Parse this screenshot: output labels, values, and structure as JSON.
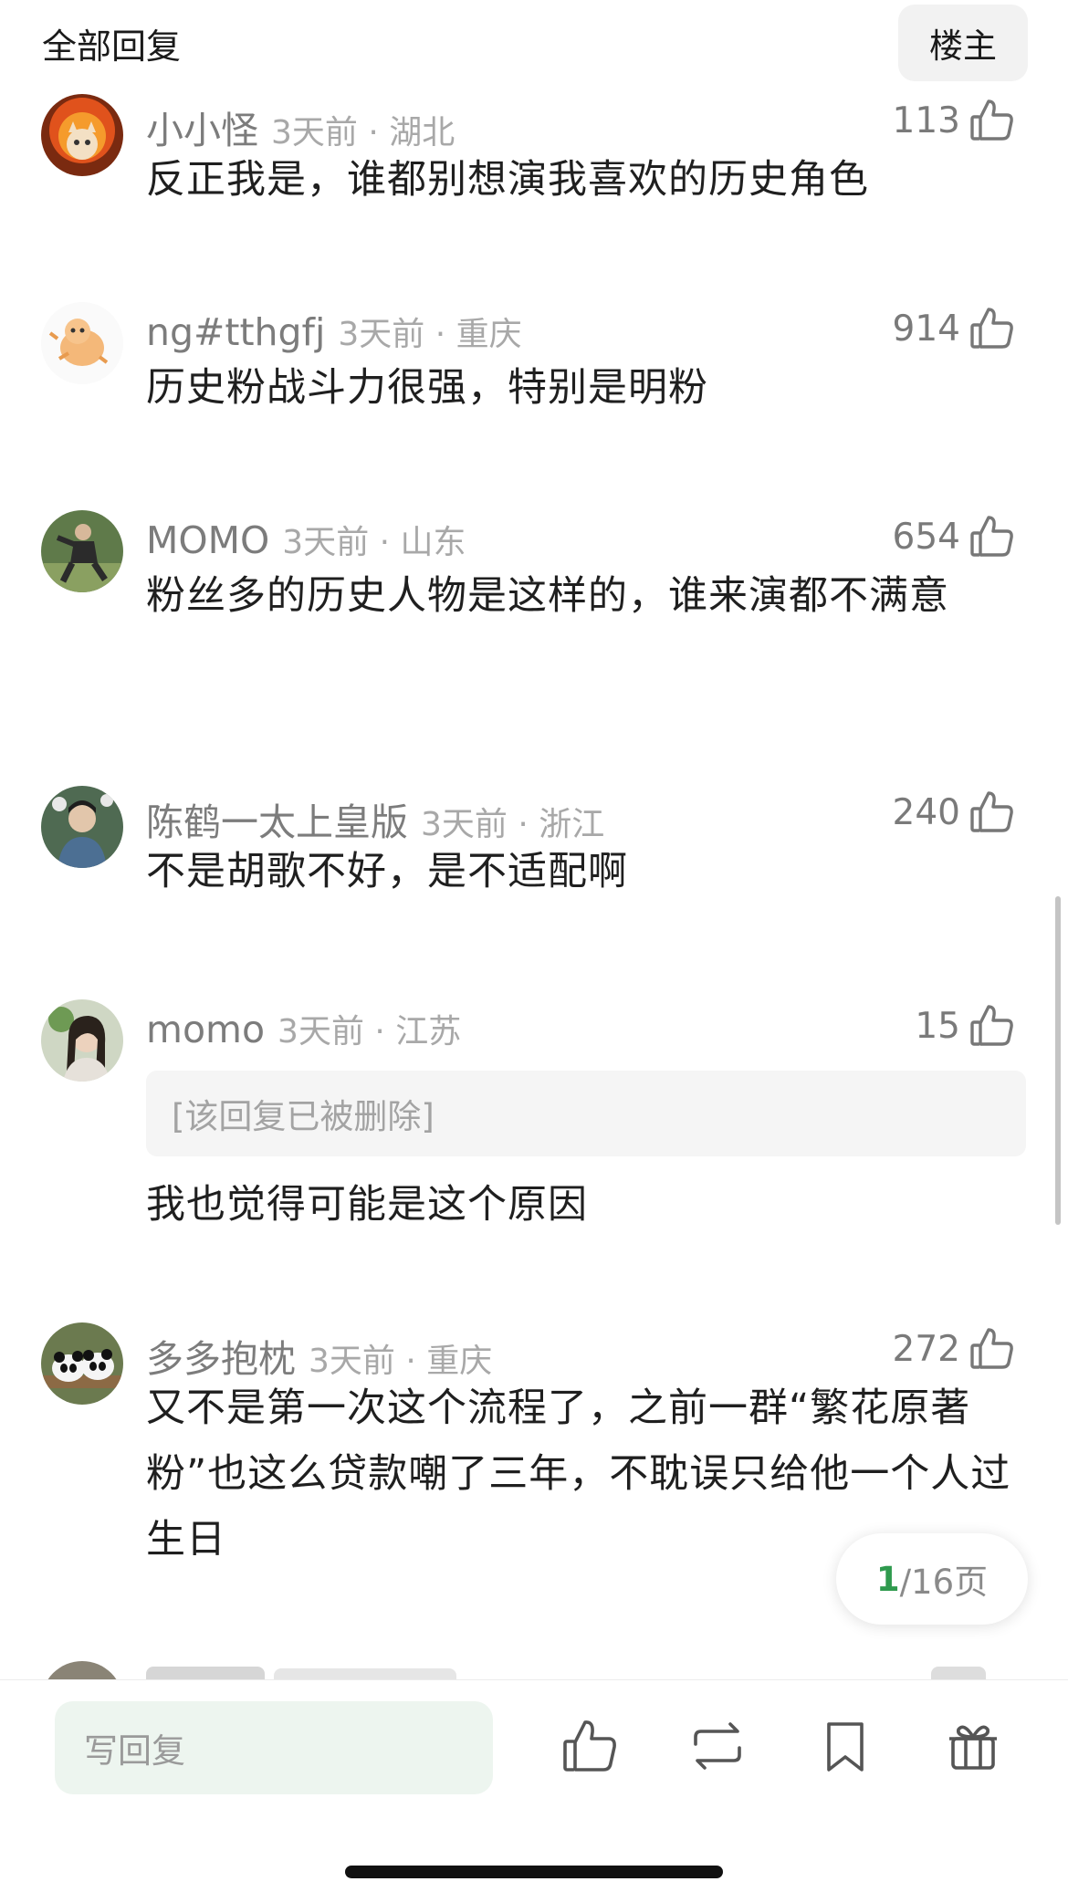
{
  "header": {
    "title": "全部回复",
    "op_button": "楼主"
  },
  "comments": [
    {
      "username": "小小怪",
      "info": "3天前 · 湖北",
      "likes": "113",
      "text": "反正我是，谁都别想演我喜欢的历史角色",
      "avatar": "flame-cat-avatar"
    },
    {
      "username": "ng#tthgfj",
      "info": "3天前 · 重庆",
      "likes": "914",
      "text": "历史粉战斗力很强，特别是明粉",
      "avatar": "cartoon-cat-avatar"
    },
    {
      "username": "MOMO",
      "info": "3天前 · 山东",
      "likes": "654",
      "text": "粉丝多的历史人物是这样的，谁来演都不满意",
      "avatar": "person-photo-avatar"
    },
    {
      "username": "陈鹤一太上皇版",
      "info": "3天前 · 浙江",
      "likes": "240",
      "text": "不是胡歌不好，是不适配啊",
      "avatar": "man-portrait-avatar"
    },
    {
      "username": "momo",
      "info": "3天前 · 江苏",
      "likes": "15",
      "quote": "[该回复已被删除]",
      "text": "我也觉得可能是这个原因",
      "avatar": "girl-portrait-avatar"
    },
    {
      "username": "多多抱枕",
      "info": "3天前 · 重庆",
      "likes": "272",
      "text": "又不是第一次这个流程了，之前一群“繁花原著粉”也这么贷款嘲了三年，不耽误只给他一个人过生日",
      "avatar": "panda-avatar"
    }
  ],
  "pagination": {
    "current": "1",
    "total": "/16页"
  },
  "bottom_bar": {
    "reply_placeholder": "写回复",
    "icons": [
      "thumbs-up-icon",
      "repost-icon",
      "bookmark-icon",
      "gift-icon"
    ]
  },
  "colors": {
    "accent_green": "#2f9a4e",
    "input_bg": "#edf5ef"
  }
}
